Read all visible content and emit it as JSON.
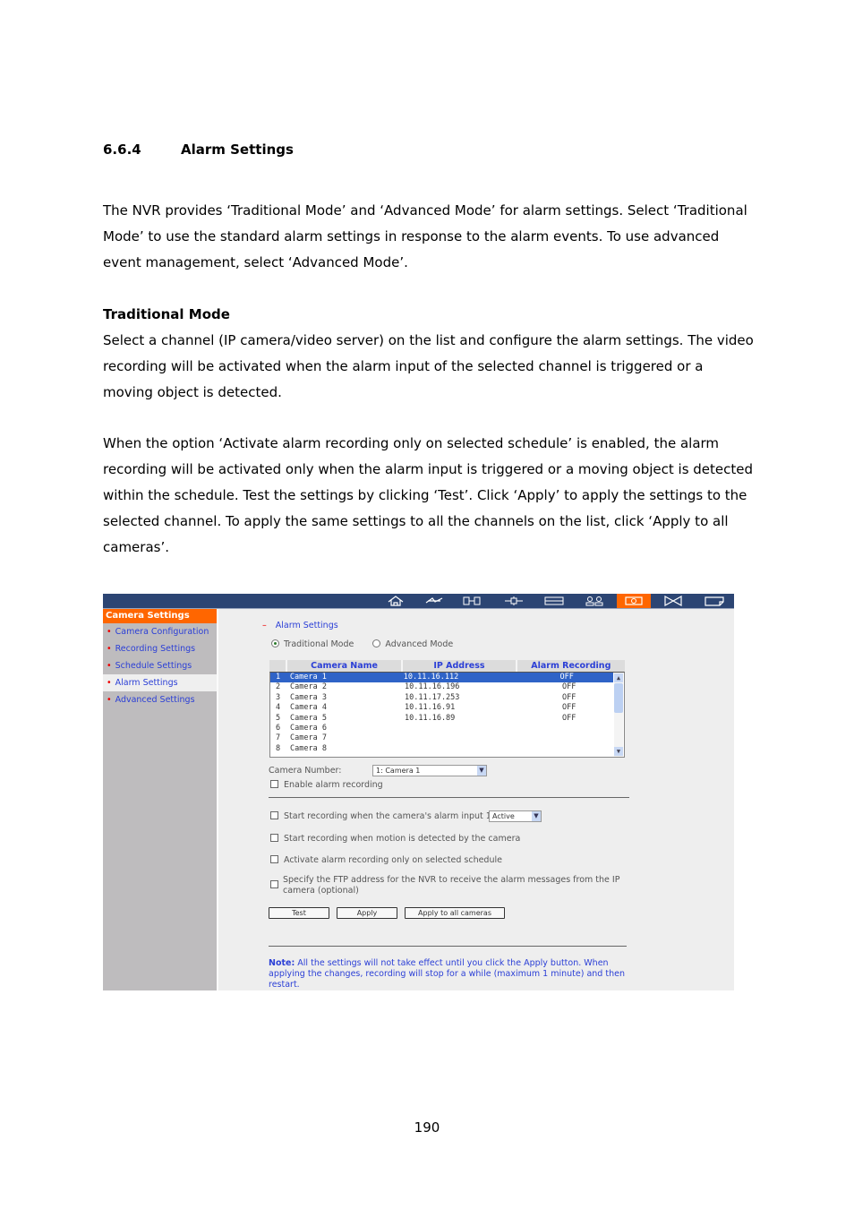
{
  "document": {
    "section_number": "6.6.4",
    "section_title": "Alarm Settings",
    "intro": "The NVR provides ‘Traditional Mode’ and ‘Advanced Mode’ for alarm settings.   Select ‘Traditional Mode’ to use the standard alarm settings in response to the alarm events.   To use advanced event management, select ‘Advanced Mode’.",
    "subheading": "Traditional Mode",
    "traditional_text": "Select a channel (IP camera/video server) on the list and configure the alarm settings. The video recording will be activated when the alarm input of the selected channel is triggered or a moving object is detected.",
    "schedule_text": "When the option ‘Activate alarm recording only on selected schedule’ is enabled, the alarm recording will be activated only when the alarm input is triggered or a moving object is detected within the schedule.   Test the settings by clicking ‘Test’.   Click ‘Apply’ to apply the settings to the selected channel.   To apply the same settings to all the channels on the list, click ‘Apply to all cameras’.",
    "page_number": "190"
  },
  "screenshot": {
    "toolbar_icons": [
      "home-icon",
      "network-icon",
      "system-tools-icon",
      "device-icon",
      "storage-icon",
      "users-icon",
      "camera-icon",
      "recording-icon",
      "logs-icon"
    ],
    "active_toolbar_icon": "camera-icon",
    "sidebar": {
      "header": "Camera Settings",
      "items": [
        {
          "label": "Camera Configuration",
          "selected": false
        },
        {
          "label": "Recording Settings",
          "selected": false
        },
        {
          "label": "Schedule Settings",
          "selected": false
        },
        {
          "label": "Alarm Settings",
          "selected": true
        },
        {
          "label": "Advanced Settings",
          "selected": false
        }
      ]
    },
    "breadcrumb": "Alarm Settings",
    "modes": [
      {
        "label": "Traditional Mode",
        "selected": true
      },
      {
        "label": "Advanced Mode",
        "selected": false
      }
    ],
    "table": {
      "headers": [
        "Camera Name",
        "IP Address",
        "Alarm Recording"
      ],
      "rows": [
        {
          "num": "1",
          "name": "Camera 1",
          "ip": "10.11.16.112",
          "rec": "OFF",
          "selected": true
        },
        {
          "num": "2",
          "name": "Camera 2",
          "ip": "10.11.16.196",
          "rec": "OFF"
        },
        {
          "num": "3",
          "name": "Camera 3",
          "ip": "10.11.17.253",
          "rec": "OFF"
        },
        {
          "num": "4",
          "name": "Camera 4",
          "ip": "10.11.16.91",
          "rec": "OFF"
        },
        {
          "num": "5",
          "name": "Camera 5",
          "ip": "10.11.16.89",
          "rec": "OFF"
        },
        {
          "num": "6",
          "name": "Camera 6",
          "ip": "",
          "rec": ""
        },
        {
          "num": "7",
          "name": "Camera 7",
          "ip": "",
          "rec": ""
        },
        {
          "num": "8",
          "name": "Camera 8",
          "ip": "",
          "rec": ""
        }
      ]
    },
    "camera_number_label": "Camera Number:",
    "camera_number_value": "1: Camera 1",
    "enable_alarm_label": "Enable alarm recording",
    "alarm_input_label": "Start recording when the camera's alarm input 1 is",
    "alarm_input_value": "Active",
    "motion_label": "Start recording when motion is detected by the camera",
    "schedule_label": "Activate alarm recording only on selected schedule",
    "ftp_label_1": "Specify the FTP address for the NVR to receive the alarm messages from the IP",
    "ftp_label_2": "camera (optional)",
    "buttons": {
      "test": "Test",
      "apply": "Apply",
      "apply_all": "Apply to all cameras"
    },
    "note_label": "Note:",
    "note_text": "All the settings will not take effect until you click the Apply button. When applying the changes, recording will stop for a while (maximum 1 minute) and then restart.",
    "colors": {
      "toolbar": "#2c4573",
      "accent": "#ff6600",
      "link": "#2b3fd6",
      "selection": "#2f63c7"
    }
  }
}
